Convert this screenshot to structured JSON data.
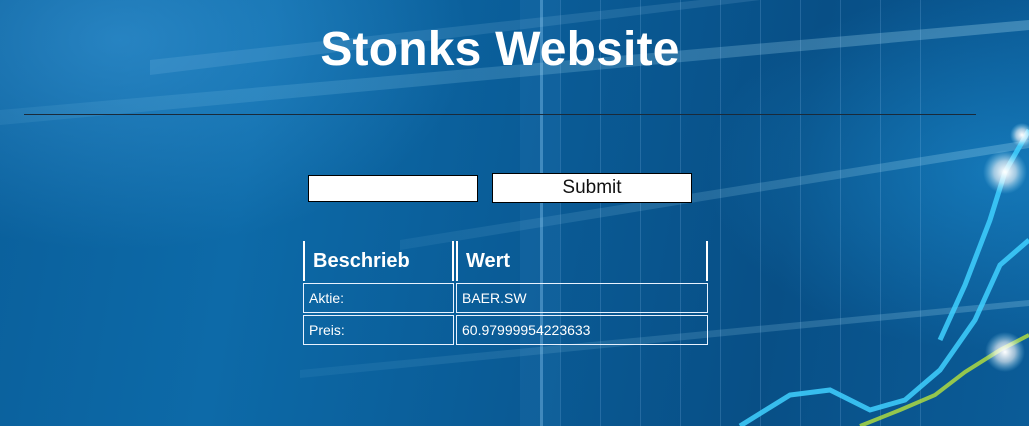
{
  "page": {
    "title": "Stonks Website"
  },
  "form": {
    "input_value": "",
    "submit_label": "Submit"
  },
  "table": {
    "headers": [
      "Beschrieb",
      "Wert"
    ],
    "rows": [
      {
        "label": "Aktie:",
        "value": "BAER.SW"
      },
      {
        "label": "Preis:",
        "value": "60.97999954223633"
      }
    ]
  },
  "colors": {
    "background": "#0a5f9b",
    "text": "#ffffff",
    "accent_line": "#3fd0ff"
  }
}
